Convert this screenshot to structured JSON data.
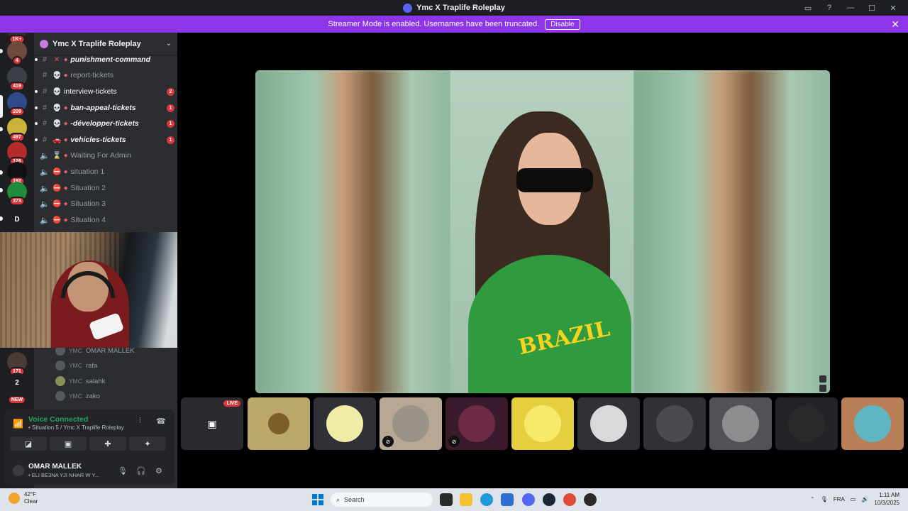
{
  "window": {
    "title": "Ymc X Traplife Roleplay"
  },
  "banner": {
    "message": "Streamer Mode is enabled. Usernames have been truncated.",
    "disable_label": "Disable"
  },
  "rail": {
    "servers": [
      {
        "badge": "1K+"
      },
      {
        "badge": "4"
      },
      {
        "badge": "419"
      },
      {
        "badge": "209"
      },
      {
        "badge": "497"
      },
      {
        "badge": "126"
      },
      {
        "badge": "192"
      },
      {
        "badge": "373"
      },
      {
        "label": "D"
      },
      {
        "badge": "171"
      },
      {
        "label": "2"
      },
      {
        "badge": "NEW"
      }
    ]
  },
  "guild": {
    "name": "Ymc X Traplife Roleplay"
  },
  "channels": [
    {
      "name": "punishment-command",
      "emoji": "✕",
      "bold": true
    },
    {
      "name": "report-tickets",
      "emoji": "💀",
      "bold": false
    },
    {
      "name": "interview-tickets",
      "emoji": "💀",
      "unread": true,
      "count": "2"
    },
    {
      "name": "ban-appeal-tickets",
      "emoji": "💀",
      "bold": true,
      "count": "1"
    },
    {
      "name": "-développer-tickets",
      "emoji": "💀",
      "bold": true,
      "count": "1"
    },
    {
      "name": "vehicles-tickets",
      "emoji": "🚗",
      "bold": true,
      "count": "1"
    },
    {
      "name": "Waiting For Admin",
      "emoji": "⌛",
      "voice": true
    },
    {
      "name": "situation 1",
      "emoji": "⛔",
      "voice": true
    },
    {
      "name": "Situation 2",
      "emoji": "⛔",
      "voice": true
    },
    {
      "name": "Situation 3",
      "emoji": "⛔",
      "voice": true
    },
    {
      "name": "Situation 4",
      "emoji": "⛔",
      "voice": true
    }
  ],
  "voice_members": [
    {
      "tag": "YMC",
      "name": "OMAR MALLEK"
    },
    {
      "tag": "YMC",
      "name": "rafa"
    },
    {
      "tag": "YMC",
      "name": "salahk"
    },
    {
      "tag": "YMC",
      "name": "zako"
    }
  ],
  "voice_panel": {
    "status": "Voice Connected",
    "channel": "• Situation 5 / Ymc X Traplife Roleplay",
    "user_name": "OMAR MALLEK",
    "user_status": "• ELI BE3NA YJI NHAR W Y..."
  },
  "tiles": [
    {
      "live": "LIVE"
    },
    {},
    {},
    {},
    {},
    {},
    {},
    {},
    {},
    {},
    {}
  ],
  "taskbar": {
    "temp": "42°F",
    "weather": "Clear",
    "search_placeholder": "Search",
    "lang": "FRA",
    "time": "1:11 AM",
    "date": "10/3/2025"
  },
  "colors": {
    "banner": "#8d35e8",
    "voice_connected": "#23a55a",
    "badge": "#da373c"
  }
}
